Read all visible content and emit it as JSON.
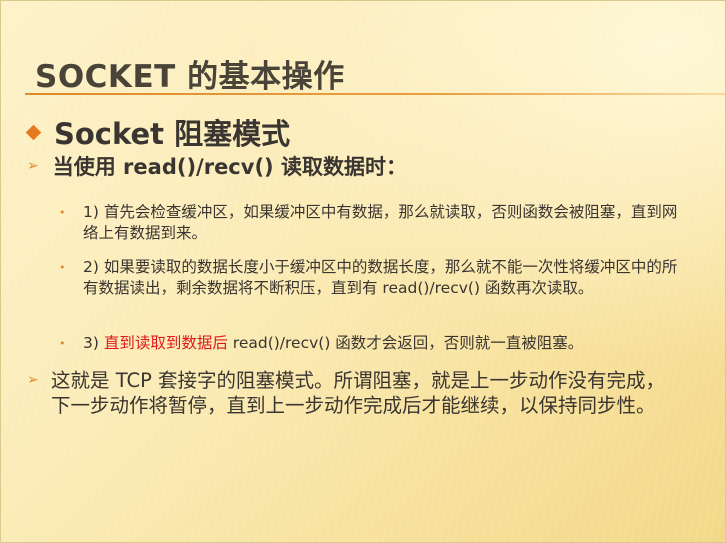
{
  "slide": {
    "title": "SOCKET 的基本操作",
    "level1": "Socket  阻塞模式",
    "level2": "当使用  read()/recv()  读取数据时：",
    "items": [
      {
        "num": "1)",
        "text": "首先会检查缓冲区，如果缓冲区中有数据，那么就读取，否则函数会被阻塞，直到网络上有数据到来。"
      },
      {
        "num": "2)",
        "text": "如果要读取的数据长度小于缓冲区中的数据长度，那么就不能一次性将缓冲区中的所有数据读出，剩余数据将不断积压，直到有  read()/recv()  函数再次读取。"
      },
      {
        "num": "3)",
        "highlight": "直到读取到数据后",
        "rest": "  read()/recv()  函数才会返回，否则就一直被阻塞。"
      }
    ],
    "summary": "这就是 TCP 套接字的阻塞模式。所谓阻塞，就是上一步动作没有完成，下一步动作将暂停，直到上一步动作完成后才能继续，以保持同步性。"
  },
  "colors": {
    "accent": "#e47b1c",
    "highlight": "#e0181a",
    "text": "#3a3530"
  },
  "icons": {
    "level1_bullet": "diamond-bullet-icon",
    "level2_bullet": "arrow-bullet-icon",
    "sub_bullet": "dot-bullet-icon"
  }
}
